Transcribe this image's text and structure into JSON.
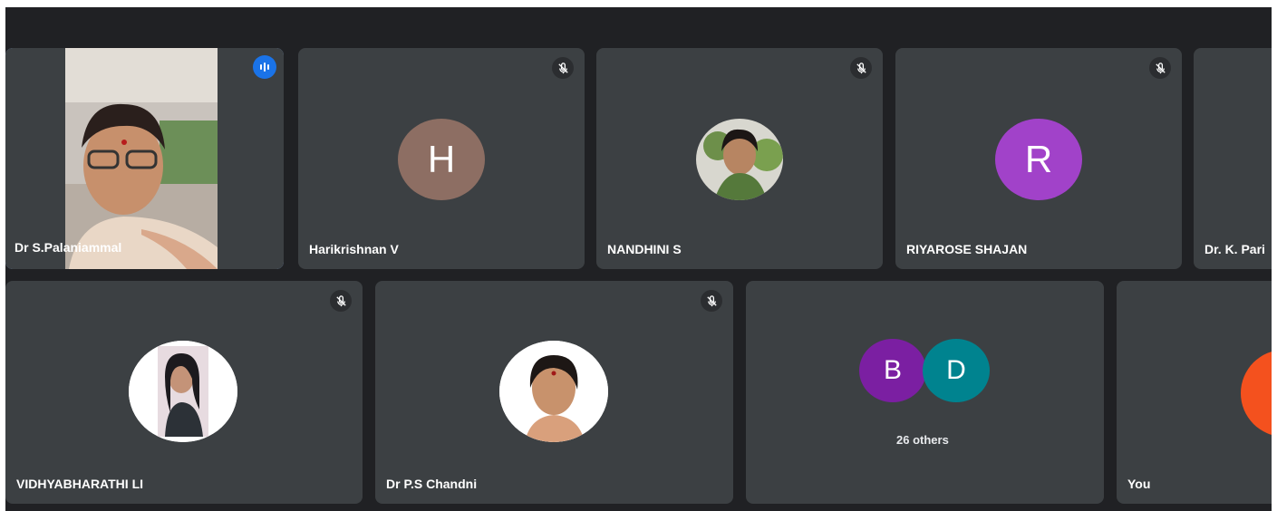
{
  "participants": [
    {
      "name": "Dr S.Palaniammal",
      "speaking": true
    },
    {
      "name": "Harikrishnan V",
      "initial": "H",
      "color": "#8d6e63"
    },
    {
      "name": "NANDHINI S"
    },
    {
      "name": "RIYAROSE SHAJAN",
      "initial": "R",
      "color": "#a142c9"
    },
    {
      "name": "Dr. K. Pari"
    },
    {
      "name": "VIDHYABHARATHI LI"
    },
    {
      "name": "Dr P.S Chandni"
    },
    {
      "name": "You",
      "color": "#f4511e"
    }
  ],
  "others": {
    "avatars": [
      {
        "initial": "B",
        "color": "#7b1fa2"
      },
      {
        "initial": "D",
        "color": "#00838f"
      }
    ],
    "label": "26 others"
  },
  "icons": {
    "muted": "mic-off-icon",
    "speaking": "audio-bars-icon"
  }
}
